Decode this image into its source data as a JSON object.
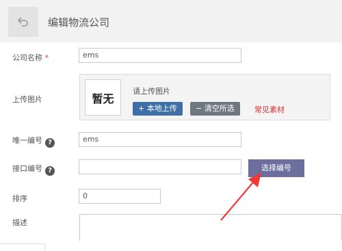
{
  "header": {
    "title": "编辑物流公司",
    "back_icon": "undo-arrow-icon"
  },
  "form": {
    "company_name": {
      "label": "公司名称",
      "required_mark": "*",
      "value": "ems"
    },
    "image": {
      "label": "上传图片",
      "placeholder_text": "暂无",
      "hint": "请上传图片",
      "upload_button": "+ 本地上传",
      "clear_button": "− 清空所选",
      "common_link": "常见素材"
    },
    "unique_code": {
      "label": "唯一编号",
      "value": "ems"
    },
    "api_code": {
      "label": "接口编号",
      "value": "",
      "select_button": "选择编号"
    },
    "sort": {
      "label": "排序",
      "value": "0"
    },
    "description": {
      "label": "描述",
      "value": ""
    }
  },
  "help_icon_text": "?",
  "colors": {
    "primary_blue": "#3e6fa6",
    "gray_button": "#6f7780",
    "purple_button": "#6c6e9e",
    "required_red": "#e63939",
    "annotation_arrow": "#f03a3a"
  }
}
